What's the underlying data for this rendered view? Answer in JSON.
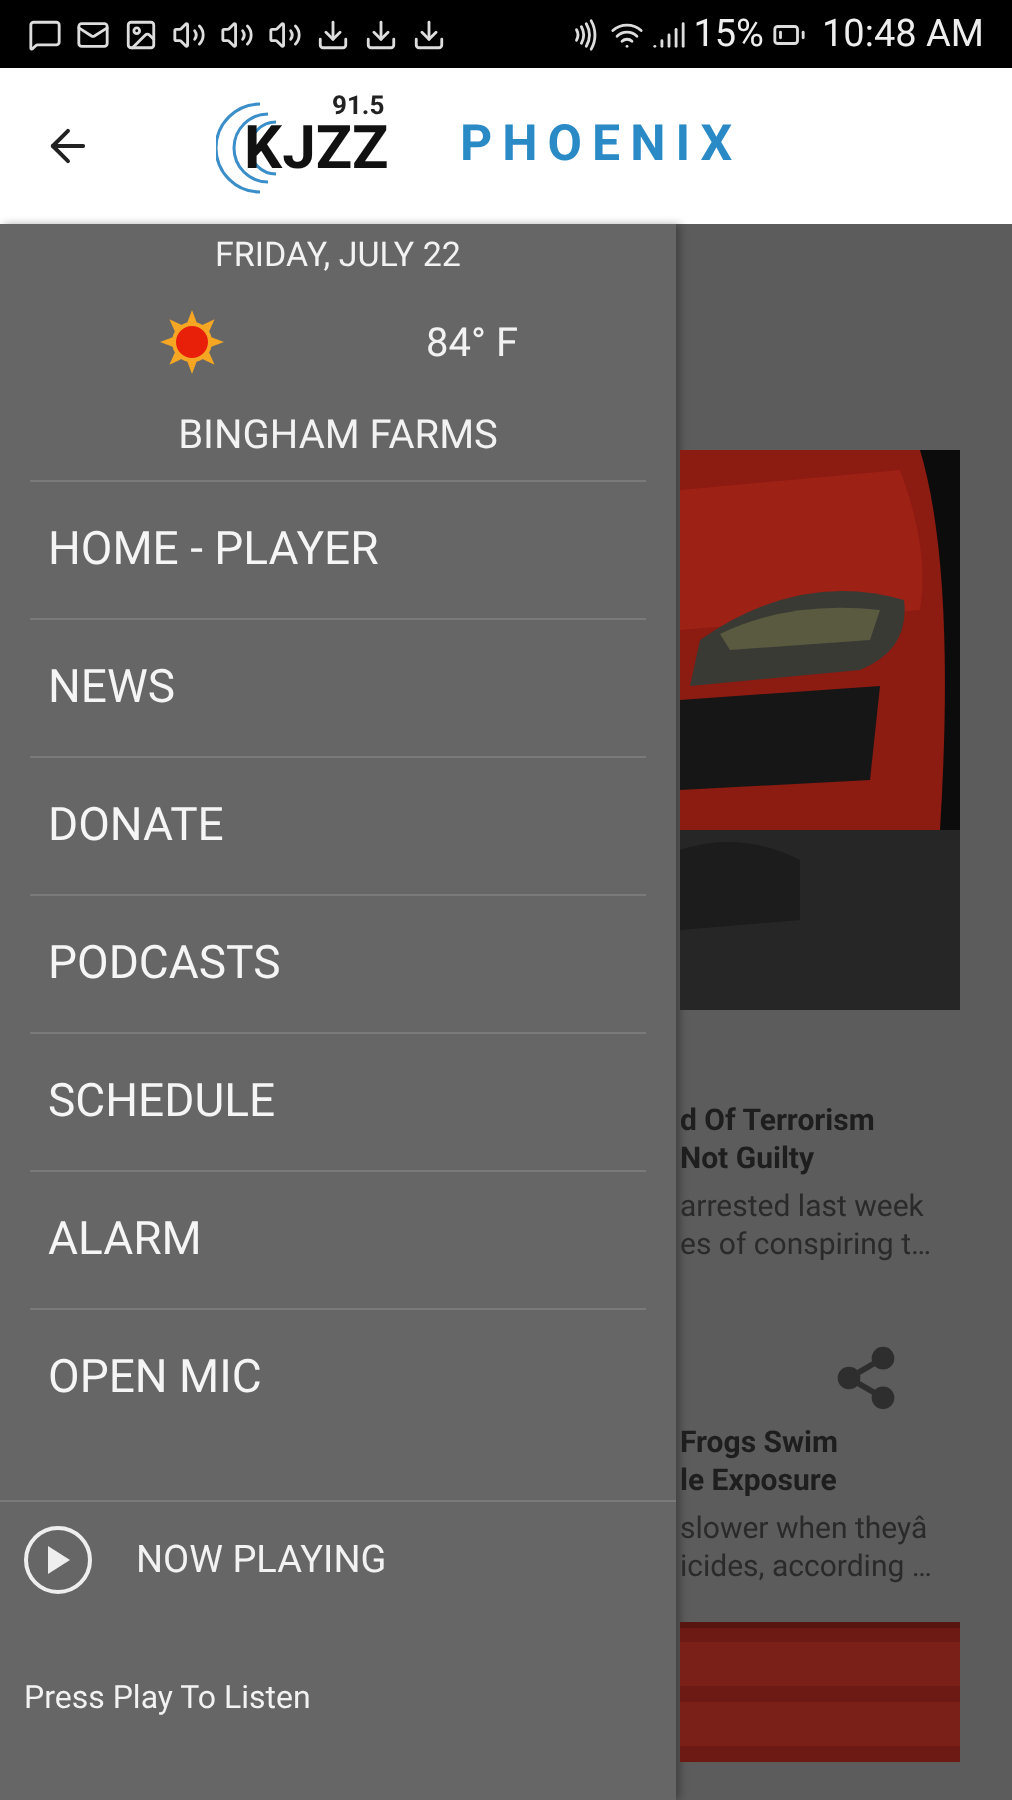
{
  "status_bar": {
    "battery": "15%",
    "time": "10:48 AM"
  },
  "header": {
    "logo_frequency": "91.5",
    "logo_text": "KJZZ",
    "city": "PHOENIX"
  },
  "drawer": {
    "date": "FRIDAY, JULY 22",
    "temperature": "84° F",
    "location": "BINGHAM FARMS",
    "menu": [
      {
        "label": "HOME - PLAYER"
      },
      {
        "label": "NEWS"
      },
      {
        "label": "DONATE"
      },
      {
        "label": "PODCASTS"
      },
      {
        "label": "SCHEDULE"
      },
      {
        "label": "ALARM"
      },
      {
        "label": "OPEN MIC"
      }
    ],
    "now_playing": {
      "label": "NOW PLAYING",
      "hint": "Press Play To Listen"
    }
  },
  "feed": {
    "articles": [
      {
        "title": [
          "d Of Terrorism",
          "Not Guilty"
        ],
        "summary": [
          "arrested last week",
          "es of conspiring t…"
        ]
      },
      {
        "title": [
          "Frogs Swim",
          "le Exposure"
        ],
        "summary": [
          "slower when theyâ",
          "icides, according …"
        ]
      }
    ]
  }
}
